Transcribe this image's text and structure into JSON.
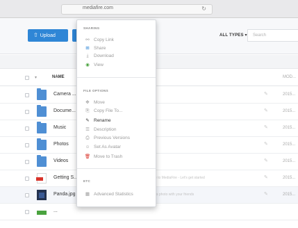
{
  "browser": {
    "url": "mediafire.com",
    "reload_icon": "reload-icon"
  },
  "toolbar": {
    "upload_label": "Upload",
    "upload_arrow": "⇧",
    "filter_label": "ALL TYPES ▾",
    "search_placeholder": "Search"
  },
  "table": {
    "header": {
      "caret": "▾",
      "name": "NAME",
      "modified": "MOD..."
    },
    "rows": [
      {
        "name": "Camera ...",
        "sub": "",
        "date": "2015..."
      },
      {
        "name": "Docume...",
        "sub": "",
        "date": "2015..."
      },
      {
        "name": "Music",
        "sub": "",
        "date": "2015..."
      },
      {
        "name": "Photos",
        "sub": "",
        "date": "2015..."
      },
      {
        "name": "Videos",
        "sub": "",
        "date": "2015..."
      },
      {
        "name": "Getting S...",
        "sub": "Welcome to MediaFire - Let's get started",
        "date": "2015..."
      },
      {
        "name": "Panda.jpg",
        "sub": "Share this photo with your friends",
        "date": "2015..."
      },
      {
        "name": "...",
        "sub": "",
        "date": ""
      }
    ]
  },
  "menu": {
    "sharing_header": "SHARING",
    "sharing_items": [
      {
        "icon": "⚯",
        "label": "Copy Link"
      },
      {
        "icon": "⊞",
        "label": "Share"
      },
      {
        "icon": "⤓",
        "label": "Download"
      },
      {
        "icon": "◉",
        "label": "View"
      }
    ],
    "file_header": "FILE OPTIONS",
    "file_items": [
      {
        "icon": "✥",
        "label": "Move"
      },
      {
        "icon": "⎘",
        "label": "Copy File To..."
      },
      {
        "icon": "✎",
        "label": "Rename"
      },
      {
        "icon": "☰",
        "label": "Description"
      },
      {
        "icon": "⎙",
        "label": "Previous Versions"
      },
      {
        "icon": "☺",
        "label": "Set As Avatar"
      },
      {
        "icon": "🗑",
        "label": "Move to Trash"
      }
    ],
    "etc_header": "ETC",
    "etc_items": [
      {
        "icon": "▦",
        "label": "Advanced Statistics"
      }
    ]
  },
  "colors": {
    "accent": "#2f86d6",
    "folder": "#4f8fd4",
    "trash": "#d9342b",
    "view": "#4aa33f"
  }
}
